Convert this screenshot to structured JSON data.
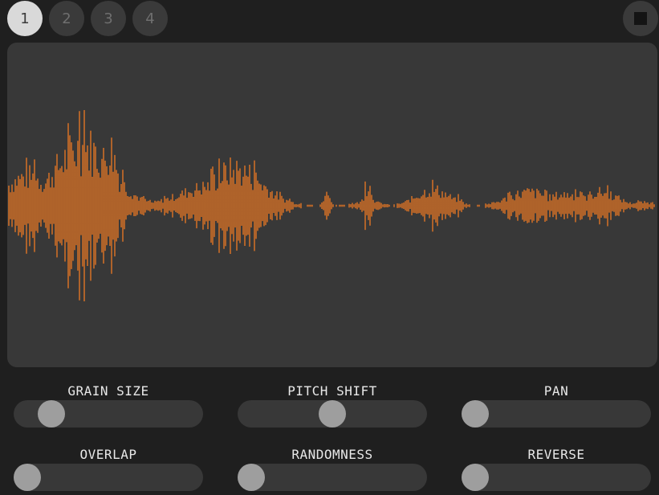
{
  "tabs": [
    {
      "label": "1",
      "active": true
    },
    {
      "label": "2",
      "active": false
    },
    {
      "label": "3",
      "active": false
    },
    {
      "label": "4",
      "active": false
    }
  ],
  "stop_button": {
    "icon": "stop-icon"
  },
  "waveform": {
    "color": "#ef7a24",
    "background": "#383838"
  },
  "controls": [
    {
      "id": "grain-size",
      "label": "GRAIN SIZE",
      "value": 0.15
    },
    {
      "id": "pitch-shift",
      "label": "PITCH SHIFT",
      "value": 0.5
    },
    {
      "id": "pan",
      "label": "PAN",
      "value": 0.0
    },
    {
      "id": "overlap",
      "label": "OVERLAP",
      "value": 0.0
    },
    {
      "id": "randomness",
      "label": "RANDOMNESS",
      "value": 0.0
    },
    {
      "id": "reverse",
      "label": "REVERSE",
      "value": 0.0
    }
  ]
}
